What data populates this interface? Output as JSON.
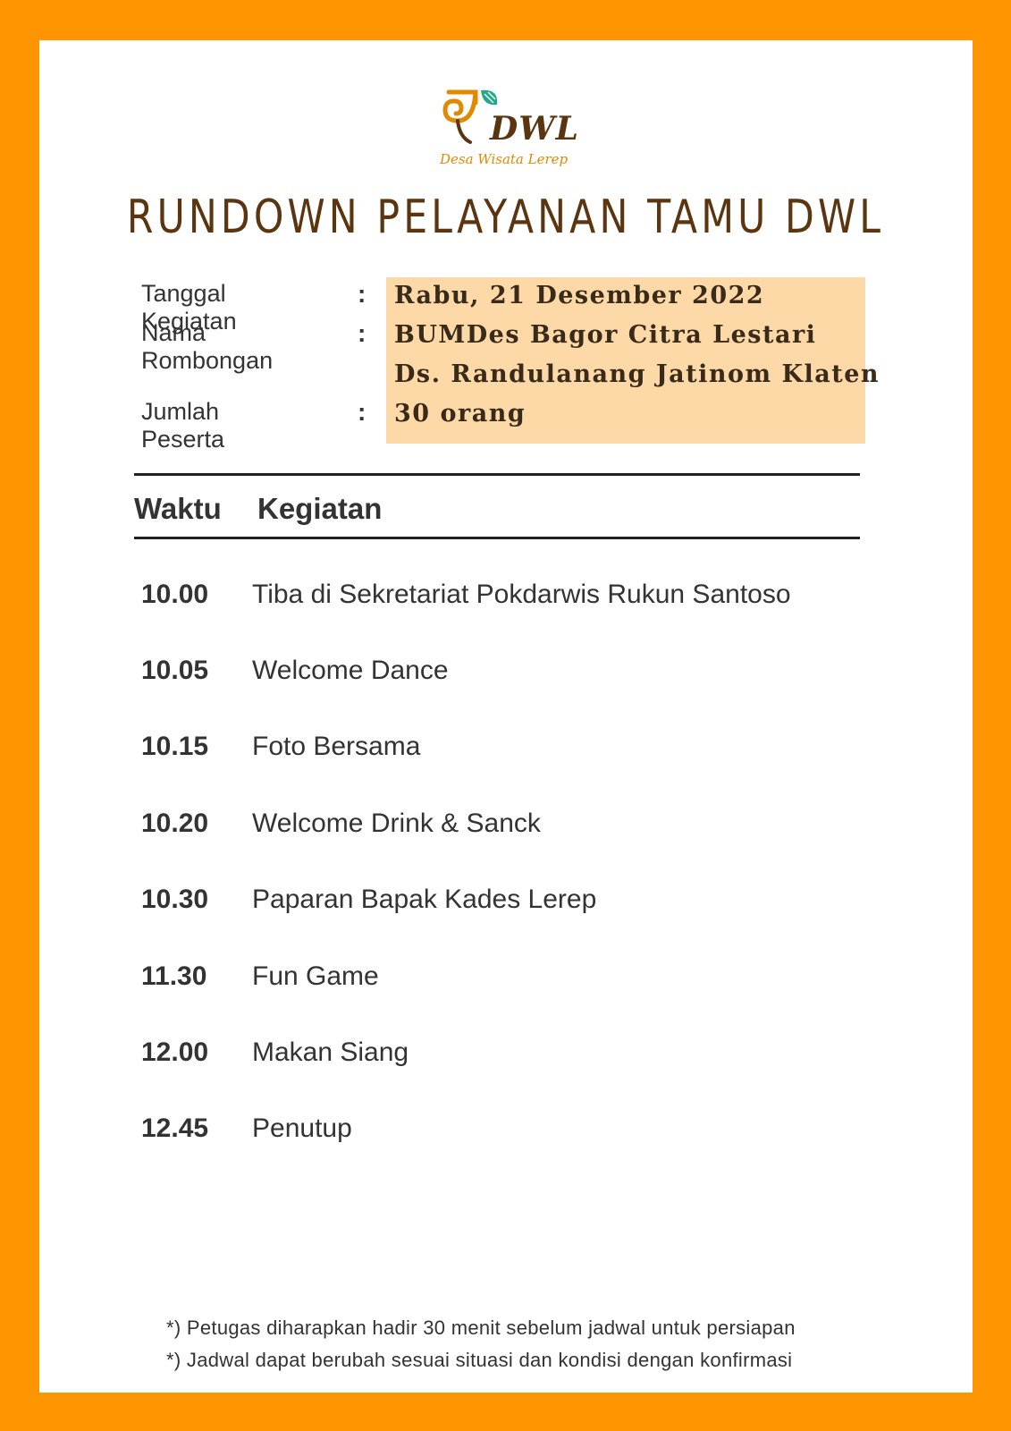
{
  "logo": {
    "mark": "DWL",
    "subtitle": "Desa Wisata Lerep"
  },
  "title": "RUNDOWN PELAYANAN TAMU DWL",
  "info": {
    "date_label": "Tanggal Kegiatan",
    "date_value": "Rabu, 21 Desember 2022",
    "group_label": "Nama Rombongan",
    "group_value_line1": "BUMDes Bagor Citra Lestari",
    "group_value_line2": "Ds. Randulanang Jatinom Klaten",
    "count_label": "Jumlah Peserta",
    "count_value": "30 orang",
    "colon": ":"
  },
  "table": {
    "headers": {
      "time": "Waktu",
      "activity": "Kegiatan"
    },
    "rows": [
      {
        "time": "10.00",
        "activity": "Tiba di Sekretariat Pokdarwis Rukun Santoso"
      },
      {
        "time": "10.05",
        "activity": "Welcome Dance"
      },
      {
        "time": "10.15",
        "activity": "Foto Bersama"
      },
      {
        "time": "10.20",
        "activity": "Welcome Drink & Sanck"
      },
      {
        "time": "10.30",
        "activity": "Paparan Bapak Kades Lerep"
      },
      {
        "time": "11.30",
        "activity": "Fun Game"
      },
      {
        "time": "12.00",
        "activity": "Makan Siang"
      },
      {
        "time": "12.45",
        "activity": "Penutup"
      }
    ]
  },
  "notes": [
    "*) Petugas diharapkan hadir 30 menit sebelum jadwal untuk persiapan",
    "*) Jadwal dapat berubah sesuai situasi dan kondisi dengan konfirmasi"
  ],
  "colors": {
    "frame": "#FF9500",
    "title": "#5a3510",
    "highlight": "#FDD9A8",
    "logo_orange": "#E08A00",
    "logo_teal": "#1FA88A"
  }
}
